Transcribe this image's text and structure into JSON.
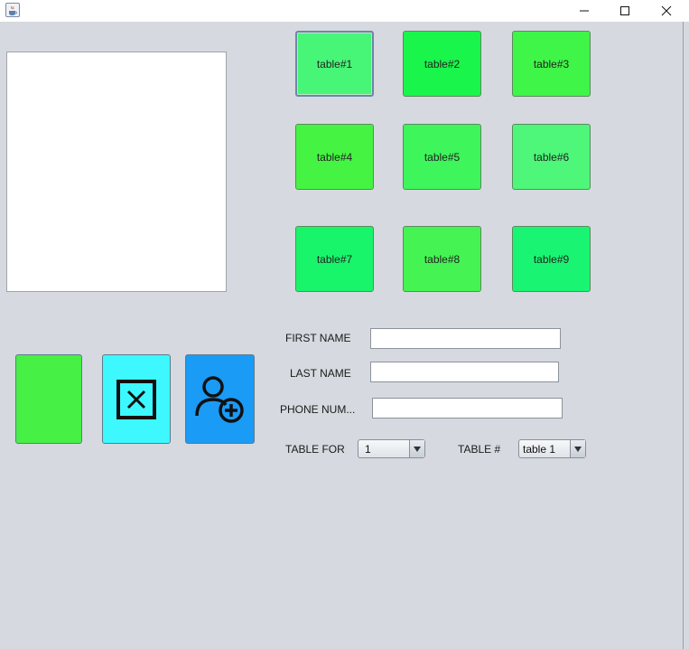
{
  "window": {
    "title": "",
    "app_icon": "java-cup-icon",
    "controls": {
      "minimize": "minimize-icon",
      "maximize": "maximize-icon",
      "close": "close-icon"
    }
  },
  "tables": [
    {
      "label": "table#1",
      "color": "#47f577"
    },
    {
      "label": "table#2",
      "color": "#19f54b"
    },
    {
      "label": "table#3",
      "color": "#3ff548"
    },
    {
      "label": "table#4",
      "color": "#45f343"
    },
    {
      "label": "table#5",
      "color": "#3ef55b"
    },
    {
      "label": "table#6",
      "color": "#4ef679"
    },
    {
      "label": "table#7",
      "color": "#19f56b"
    },
    {
      "label": "table#8",
      "color": "#45f453"
    },
    {
      "label": "table#9",
      "color": "#19f572"
    }
  ],
  "actions": {
    "green_button": {
      "color": "#46f044",
      "icon": ""
    },
    "delete_button": {
      "color": "#3df8ff",
      "icon": "delete-box-icon"
    },
    "add_user_button": {
      "color": "#1a9bf6",
      "icon": "add-user-icon"
    }
  },
  "form": {
    "first_name_label": "FIRST NAME",
    "first_name_value": "",
    "last_name_label": "LAST NAME",
    "last_name_value": "",
    "phone_label": "PHONE NUM...",
    "phone_value": "",
    "table_for_label": "TABLE FOR",
    "table_for_value": "1",
    "table_num_label": "TABLE #",
    "table_num_value": "table 1"
  }
}
